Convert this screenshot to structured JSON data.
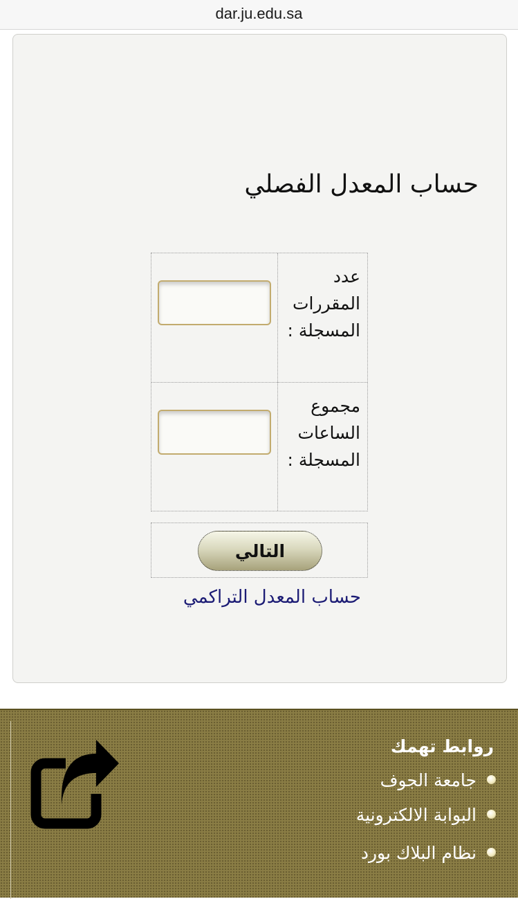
{
  "browser": {
    "url": "dar.ju.edu.sa"
  },
  "page": {
    "title": "حساب المعدل الفصلي"
  },
  "form": {
    "courses_label": "عدد المقررات المسجلة :",
    "courses_value": "",
    "hours_label": "مجموع الساعات المسجلة :",
    "hours_value": "",
    "next_button": "التالي",
    "cumulative_link": "حساب المعدل التراكمي"
  },
  "footer": {
    "heading": "روابط تهمك",
    "links": [
      {
        "label": "جامعة الجوف"
      },
      {
        "label": "البوابة الالكترونية"
      },
      {
        "label": "نظام البلاك بورد"
      }
    ],
    "icon": "external-link-icon"
  },
  "colors": {
    "footer_bg": "#8a7d45",
    "link_color": "#1c1c75",
    "input_border": "#c2ab6e"
  }
}
